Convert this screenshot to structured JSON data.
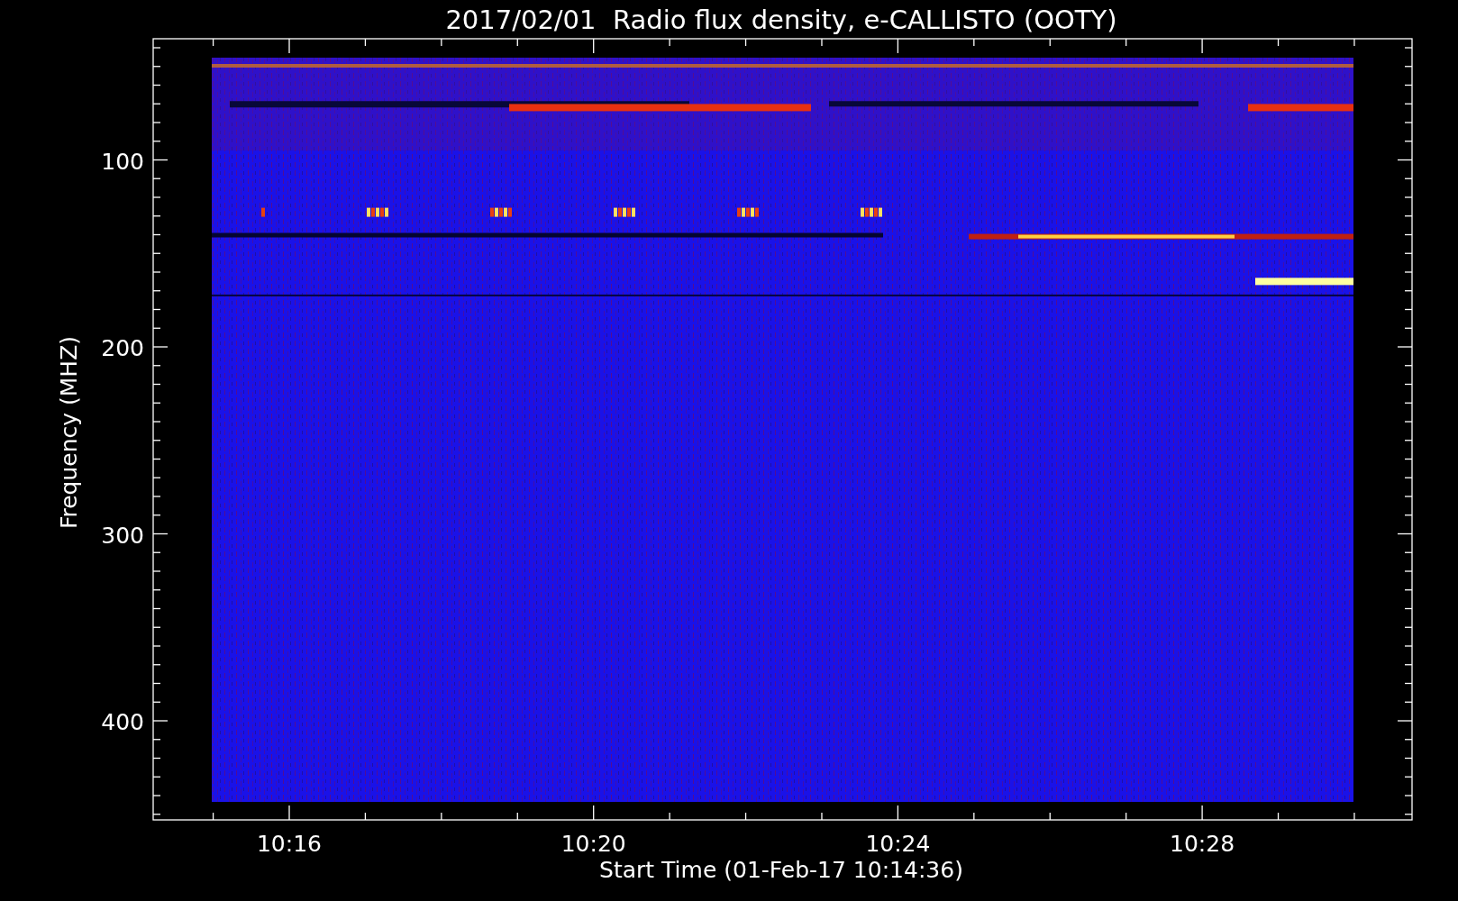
{
  "title": "2017/02/01  Radio flux density, e-CALLISTO (OOTY)",
  "ylabel": "Frequency (MHZ)",
  "xlabel": "Start Time (01-Feb-17 10:14:36)",
  "yticks": [
    "100",
    "200",
    "300",
    "400"
  ],
  "xticks": [
    "10:16",
    "10:20",
    "10:24",
    "10:28"
  ]
}
